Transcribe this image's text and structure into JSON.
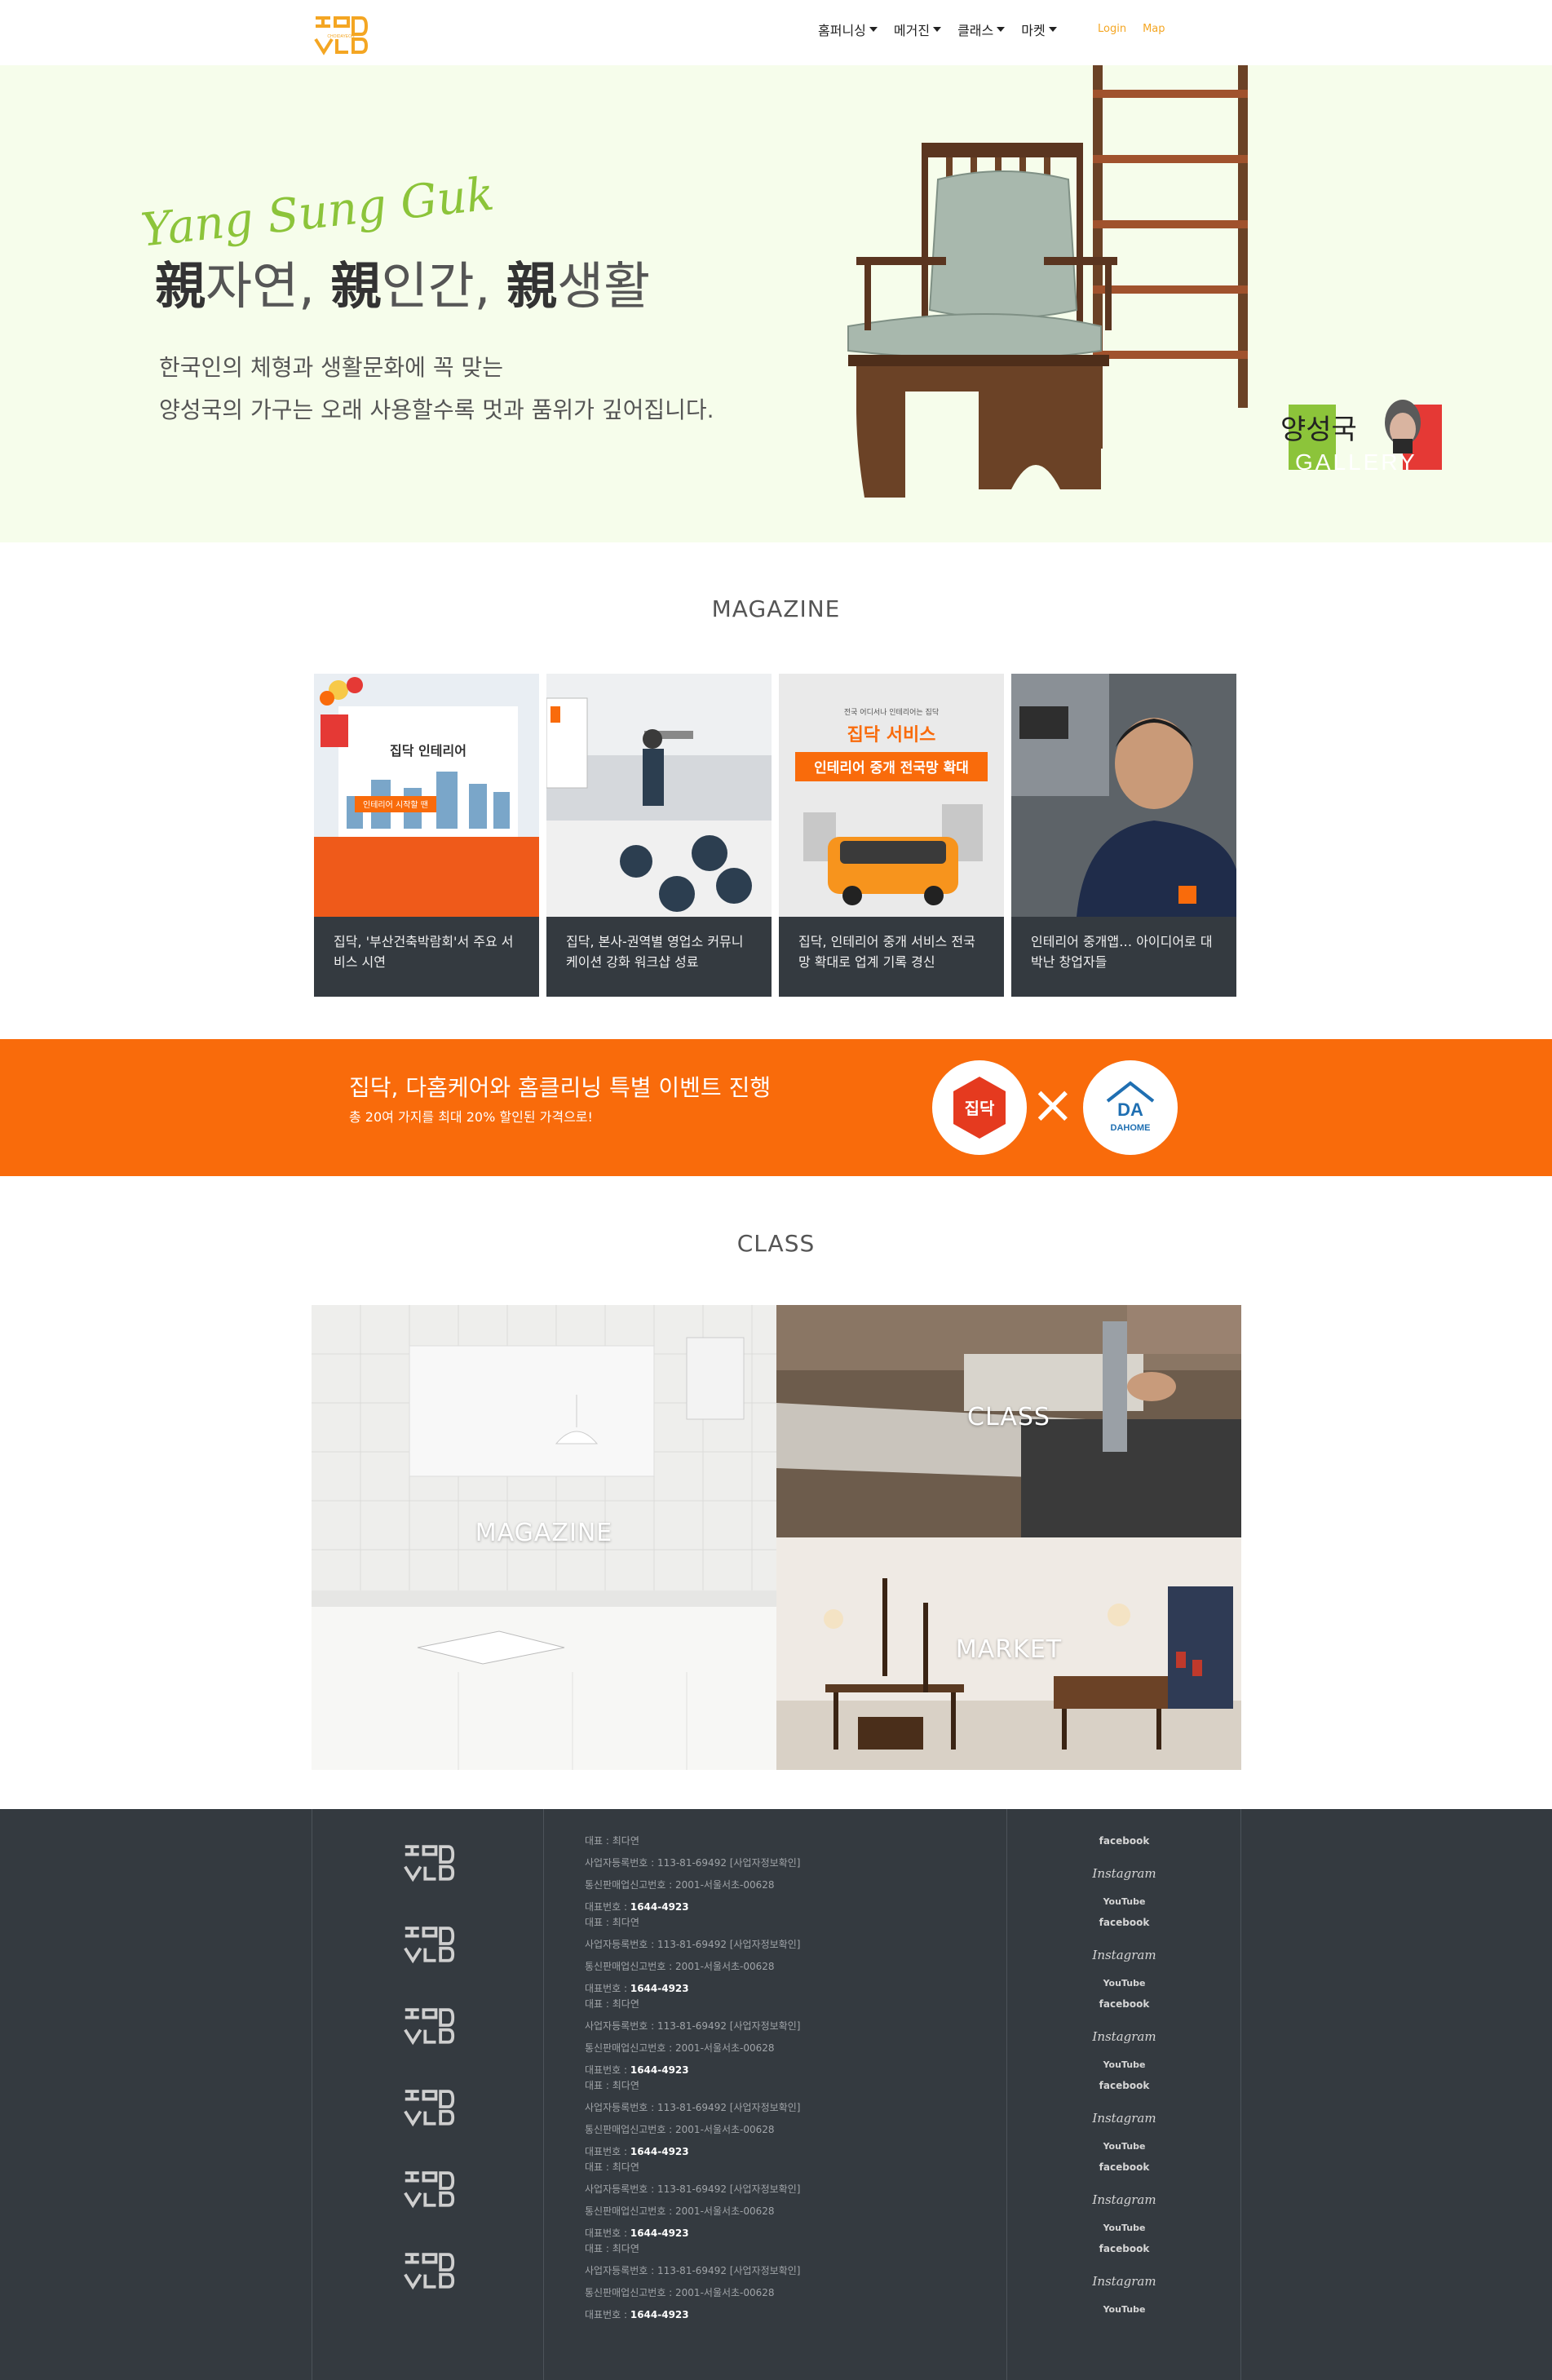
{
  "nav": {
    "logo_text": "CHOIDAYEON",
    "menu": [
      {
        "label": "홈퍼니싱"
      },
      {
        "label": "메거진"
      },
      {
        "label": "클래스"
      },
      {
        "label": "마켓"
      }
    ],
    "login": "Login",
    "map": "Map"
  },
  "hero": {
    "script_title": "Yang Sung Guk",
    "headline_parts": [
      "親",
      "자연, ",
      "親",
      "인간, ",
      "親",
      "생활"
    ],
    "sub_line1": "한국인의 체형과 생활문화에 꼭 맞는",
    "sub_line2": "양성국의 가구는 오래 사용할수록 멋과 품위가 깊어집니다.",
    "badge_kr": "양성국",
    "badge_en": "GALLERY"
  },
  "magazine": {
    "title": "MAGAZINE",
    "cards": [
      {
        "caption": "집닥, '부산건축박람회'서 주요 서비스 시연",
        "img_title": "집닥 인테리어",
        "img_sub": "인테리어 시작할 땐"
      },
      {
        "caption": "집닥, 본사-권역별 영업소 커뮤니케이션 강화 워크샵 성료"
      },
      {
        "caption": "집닥, 인테리어 중개 서비스 전국망 확대로 업계 기록 경신",
        "img_top": "전국 어디서나 인테리어는 집닥",
        "img_title": "집닥 서비스",
        "img_sub": "인테리어 중개 전국망 확대"
      },
      {
        "caption": "인테리어 중개앱… 아이디어로 대박난 창업자들"
      }
    ]
  },
  "banner": {
    "title": "집닥, 다홈케어와 홈클리닝 특별 이벤트 진행",
    "subtitle": "총 20여 가지를 최대 20% 할인된 가격으로!",
    "logo_left": "집닥",
    "logo_right": "DAHOME",
    "times": "×"
  },
  "class_section": {
    "title": "CLASS",
    "tiles": [
      {
        "label": "MAGAZINE"
      },
      {
        "label": "CLASS"
      },
      {
        "label": "MARKET"
      }
    ]
  },
  "footer": {
    "rows": [
      {
        "ceo": "대표 : 최다연",
        "biz": "사업자등록번호 : 113-81-69492 [사업자정보확인]",
        "mail": "통신판매업신고번호 : 2001-서울서초-00628",
        "phone_label": "대표번호 : ",
        "phone": "1644-4923"
      },
      {
        "ceo": "대표 : 최다연",
        "biz": "사업자등록번호 : 113-81-69492 [사업자정보확인]",
        "mail": "통신판매업신고번호 : 2001-서울서초-00628",
        "phone_label": "대표번호 : ",
        "phone": "1644-4923"
      },
      {
        "ceo": "대표 : 최다연",
        "biz": "사업자등록번호 : 113-81-69492 [사업자정보확인]",
        "mail": "통신판매업신고번호 : 2001-서울서초-00628",
        "phone_label": "대표번호 : ",
        "phone": "1644-4923"
      },
      {
        "ceo": "대표 : 최다연",
        "biz": "사업자등록번호 : 113-81-69492 [사업자정보확인]",
        "mail": "통신판매업신고번호 : 2001-서울서초-00628",
        "phone_label": "대표번호 : ",
        "phone": "1644-4923"
      },
      {
        "ceo": "대표 : 최다연",
        "biz": "사업자등록번호 : 113-81-69492 [사업자정보확인]",
        "mail": "통신판매업신고번호 : 2001-서울서초-00628",
        "phone_label": "대표번호 : ",
        "phone": "1644-4923"
      },
      {
        "ceo": "대표 : 최다연",
        "biz": "사업자등록번호 : 113-81-69492 [사업자정보확인]",
        "mail": "통신판매업신고번호 : 2001-서울서초-00628",
        "phone_label": "대표번호 : ",
        "phone": "1644-4923"
      }
    ],
    "social": {
      "facebook": "facebook",
      "instagram": "Instagram",
      "youtube": "YouTube"
    }
  },
  "colors": {
    "accent_orange": "#f96b0b",
    "logo_orange": "#f4a623",
    "hero_bg": "#f6fdeb",
    "script_green": "#8cc43a",
    "footer_bg": "#343a40"
  },
  "icons": [
    "logo-icon",
    "caret-down-icon",
    "chair-image",
    "gallery-badge",
    "dahome-logo",
    "zipdoc-logo",
    "facebook-icon",
    "instagram-icon",
    "youtube-icon"
  ]
}
